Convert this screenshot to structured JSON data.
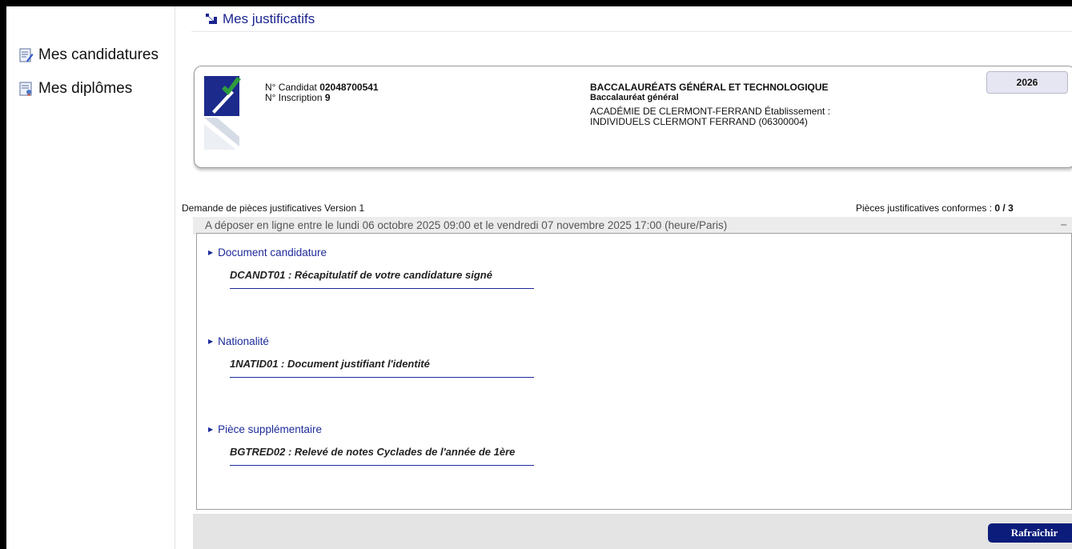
{
  "sidebar": {
    "items": [
      {
        "label": "Mes candidatures",
        "icon": "document-edit-icon"
      },
      {
        "label": "Mes diplômes",
        "icon": "diploma-icon"
      }
    ]
  },
  "header": {
    "title": "Mes justificatifs",
    "icon": "arrow-down-right-icon"
  },
  "candidate": {
    "candidat_label": "N° Candidat",
    "candidat_number": "02048700541",
    "inscription_label": "N° Inscription",
    "inscription_number": "9",
    "exam_title": "BACCALAURÉATS GÉNÉRAL ET TECHNOLOGIQUE",
    "exam_subtitle": "Baccalauréat général",
    "academy": "ACADÉMIE DE CLERMONT-FERRAND Établissement :",
    "school": "INDIVIDUELS CLERMONT FERRAND (06300004)",
    "year": "2026"
  },
  "request": {
    "title": "Demande de pièces justificatives Version 1",
    "conformes_label": "Pièces justificatives conformes : ",
    "conformes_value": "0 / 3",
    "deposit_window": "A déposer en ligne entre le lundi 06 octobre 2025 09:00 et le vendredi 07 novembre 2025 17:00 (heure/Paris)",
    "collapse_symbol": "−"
  },
  "sections": [
    {
      "title": "Document candidature",
      "document": "DCANDT01 : Récapitulatif de votre candidature signé"
    },
    {
      "title": "Nationalité",
      "document": "1NATID01 : Document justifiant l'identité"
    },
    {
      "title": "Pièce supplémentaire",
      "document": "BGTRED02 : Relevé de notes Cyclades de l'année de 1ère"
    }
  ],
  "footer": {
    "refresh_label": "Rafraîchir"
  },
  "colors": {
    "accent": "#1d2a9a",
    "button": "#0b1c7a",
    "panel": "#ececec"
  }
}
